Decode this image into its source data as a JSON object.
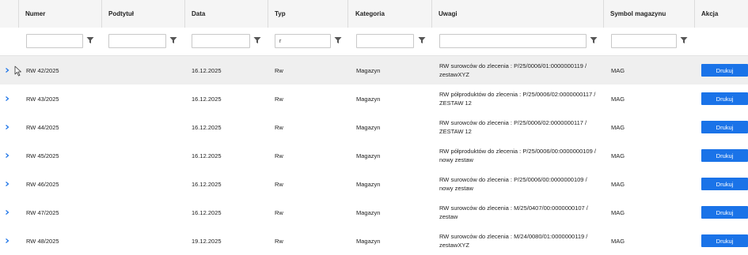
{
  "columns": [
    "Numer",
    "Podtytuł",
    "Data",
    "Typ",
    "Kategoria",
    "Uwagi",
    "Symbol magazynu",
    "Akcja"
  ],
  "filters": {
    "numer": "",
    "podtytul": "",
    "data": "",
    "typ": "r",
    "kategoria": "",
    "uwagi": "",
    "symbol": ""
  },
  "rows": [
    {
      "numer": "RW 42/2025",
      "podtytul": "",
      "data": "16.12.2025",
      "typ": "Rw",
      "kategoria": "Magazyn",
      "uwagi_1": "RW surowców do zlecenia : P/25/0006/01:0000000119 /",
      "uwagi_2": "zestawXYZ",
      "symbol": "MAG",
      "akcja": "Drukuj"
    },
    {
      "numer": "RW 43/2025",
      "podtytul": "",
      "data": "16.12.2025",
      "typ": "Rw",
      "kategoria": "Magazyn",
      "uwagi_1": "RW półproduktów do zlecenia : P/25/0006/02:0000000117 /",
      "uwagi_2": "ZESTAW 12",
      "symbol": "MAG",
      "akcja": "Drukuj"
    },
    {
      "numer": "RW 44/2025",
      "podtytul": "",
      "data": "16.12.2025",
      "typ": "Rw",
      "kategoria": "Magazyn",
      "uwagi_1": "RW surowców do zlecenia : P/25/0006/02:0000000117 /",
      "uwagi_2": "ZESTAW 12",
      "symbol": "MAG",
      "akcja": "Drukuj"
    },
    {
      "numer": "RW 45/2025",
      "podtytul": "",
      "data": "16.12.2025",
      "typ": "Rw",
      "kategoria": "Magazyn",
      "uwagi_1": "RW półproduktów do zlecenia : P/25/0006/00:0000000109 /",
      "uwagi_2": "nowy zestaw",
      "symbol": "MAG",
      "akcja": "Drukuj"
    },
    {
      "numer": "RW 46/2025",
      "podtytul": "",
      "data": "16.12.2025",
      "typ": "Rw",
      "kategoria": "Magazyn",
      "uwagi_1": "RW surowców do zlecenia : P/25/0006/00:0000000109 /",
      "uwagi_2": "nowy zestaw",
      "symbol": "MAG",
      "akcja": "Drukuj"
    },
    {
      "numer": "RW 47/2025",
      "podtytul": "",
      "data": "16.12.2025",
      "typ": "Rw",
      "kategoria": "Magazyn",
      "uwagi_1": "RW surowców do zlecenia : M/25/0407/00:0000000107 /",
      "uwagi_2": "zestaw",
      "symbol": "MAG",
      "akcja": "Drukuj"
    },
    {
      "numer": "RW 48/2025",
      "podtytul": "",
      "data": "19.12.2025",
      "typ": "Rw",
      "kategoria": "Magazyn",
      "uwagi_1": "RW surowców do zlecenia : M/24/0080/01:0000000119 /",
      "uwagi_2": "zestawXYZ",
      "symbol": "MAG",
      "akcja": "Drukuj"
    }
  ],
  "icons": {
    "filter": "filter-funnel-icon",
    "expand": "chevron-right-icon",
    "cursor": "mouse-pointer-icon"
  },
  "colors": {
    "accent": "#1a73e8",
    "header_bg": "#f5f5f5",
    "selected_row": "#efefef"
  }
}
